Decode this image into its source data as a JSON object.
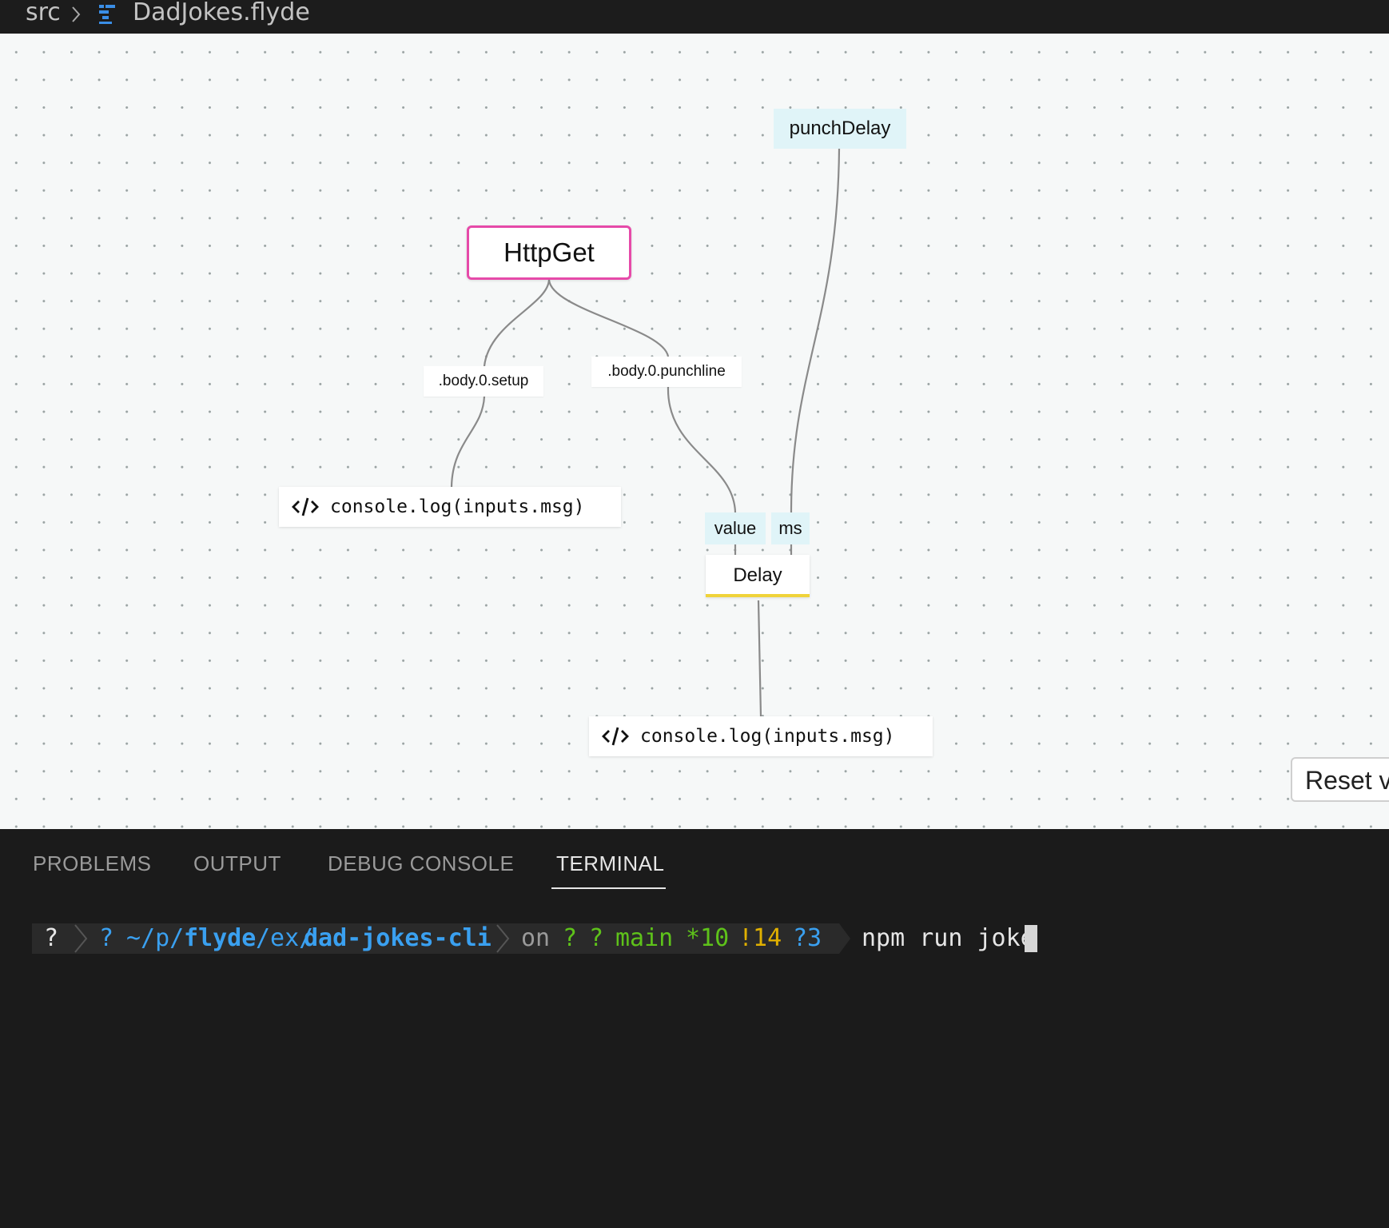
{
  "breadcrumb": {
    "folder": "src",
    "file": "DadJokes.flyde",
    "file_icon": "flyde-file-icon",
    "separator_icon": "chevron-right-icon"
  },
  "flow": {
    "nodes": {
      "httpget": "HttpGet",
      "setup_pin": ".body.0.setup",
      "punchline_pin": ".body.0.punchline",
      "punch_delay_input": "punchDelay",
      "delay_value_pin": "value",
      "delay_ms_pin": "ms",
      "delay": "Delay",
      "log_setup": "console.log(inputs.msg)",
      "log_punchline": "console.log(inputs.msg)"
    },
    "code_icon": "code-icon",
    "reset_button": "Reset v",
    "colors": {
      "httpget_border": "#e64aa9",
      "input_pin_bg": "#e0f4f8",
      "delay_underline": "#f0d33a",
      "edge": "#8a8a8a"
    }
  },
  "panel": {
    "tabs": [
      {
        "label": "PROBLEMS",
        "active": false
      },
      {
        "label": "OUTPUT",
        "active": false
      },
      {
        "label": "DEBUG CONSOLE",
        "active": false
      },
      {
        "label": "TERMINAL",
        "active": true
      }
    ]
  },
  "terminal": {
    "os_glyph": "?",
    "folder_glyph": "?",
    "path_prefix": "~/p/",
    "path_flyde": "flyde",
    "path_mid": "/ex/",
    "path_project": "dad-jokes-cli",
    "on": "on",
    "git_glyph1": "?",
    "git_glyph2": "?",
    "branch": "main",
    "stashed": "*10",
    "modified": "!14",
    "untracked": "?3",
    "command": "npm run joke",
    "colors": {
      "path": "#3aa0f0",
      "git": "#5ec21a",
      "modified": "#e0b000",
      "untracked": "#3aa0f0",
      "on": "#9a9a9a",
      "command": "#e6e6e6"
    }
  }
}
